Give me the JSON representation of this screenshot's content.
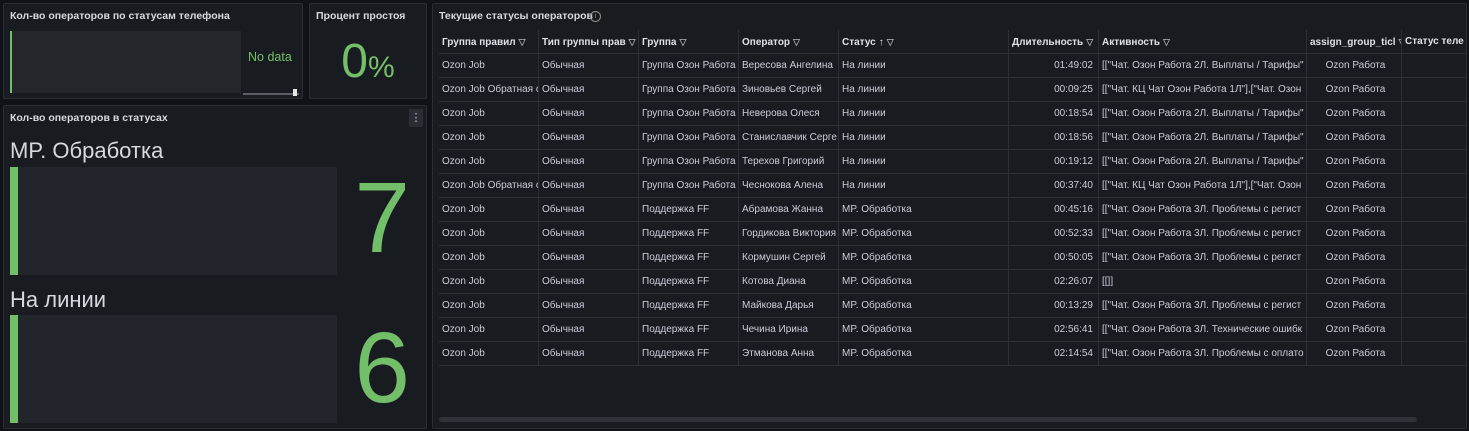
{
  "colors": {
    "accent": "#73bf69",
    "panel_bg": "#181b1f",
    "page_bg": "#111217"
  },
  "panel_phone_status": {
    "title": "Кол-во операторов по статусам телефона",
    "no_data": "No data"
  },
  "panel_idle": {
    "title": "Процент простоя",
    "value": "0",
    "unit": "%"
  },
  "panel_statuses": {
    "title": "Кол-во операторов в статусах",
    "menu_icon": "vertical-dots-icon",
    "items": [
      {
        "label": "MP. Обработка",
        "value": "7"
      },
      {
        "label": "На линии",
        "value": "6"
      }
    ]
  },
  "panel_table": {
    "title": "Текущие статусы операторов",
    "info_icon": "info-icon",
    "headers": [
      "Группа правил",
      "Тип группы прав",
      "Группа",
      "Оператор",
      "Статус",
      "Длительность",
      "Активность",
      "assign_group_ticl",
      "Статус теле"
    ],
    "sort_column": "Статус",
    "sort_direction": "asc",
    "rows": [
      [
        "Ozon Job",
        "Обычная",
        "Группа Озон Работа",
        "Вересова Ангелина",
        "На линии",
        "01:49:02",
        "[[\"Чат. Озон Работа 2Л. Выплаты / Тарифы\"",
        "Ozon Работа",
        ""
      ],
      [
        "Ozon Job Обратная с",
        "Обычная",
        "Группа Озон Работа",
        "Зиновьев Сергей",
        "На линии",
        "00:09:25",
        "[[\"Чат. КЦ Чат Озон Работа 1Л\"],[\"Чат. Озон",
        "Ozon Работа",
        ""
      ],
      [
        "Ozon Job",
        "Обычная",
        "Группа Озон Работа",
        "Неверова Олеся",
        "На линии",
        "00:18:54",
        "[[\"Чат. Озон Работа 2Л. Выплаты / Тарифы\"",
        "Ozon Работа",
        ""
      ],
      [
        "Ozon Job",
        "Обычная",
        "Группа Озон Работа",
        "Станиславчик Серге",
        "На линии",
        "00:18:56",
        "[[\"Чат. Озон Работа 2Л. Выплаты / Тарифы\"",
        "Ozon Работа",
        ""
      ],
      [
        "Ozon Job",
        "Обычная",
        "Группа Озон Работа",
        "Терехов Григорий",
        "На линии",
        "00:19:12",
        "[[\"Чат. Озон Работа 2Л. Выплаты / Тарифы\"",
        "Ozon Работа",
        ""
      ],
      [
        "Ozon Job Обратная с",
        "Обычная",
        "Группа Озон Работа",
        "Чеснокова Алена",
        "На линии",
        "00:37:40",
        "[[\"Чат. КЦ Чат Озон Работа 1Л\"],[\"Чат. Озон",
        "Ozon Работа",
        ""
      ],
      [
        "Ozon Job",
        "Обычная",
        "Поддержка FF",
        "Абрамова Жанна",
        "MP. Обработка",
        "00:45:16",
        "[[\"Чат. Озон Работа 3Л. Проблемы с регист",
        "Ozon Работа",
        ""
      ],
      [
        "Ozon Job",
        "Обычная",
        "Поддержка FF",
        "Гордикова Виктория",
        "MP. Обработка",
        "00:52:33",
        "[[\"Чат. Озон Работа 3Л. Проблемы с регист",
        "Ozon Работа",
        ""
      ],
      [
        "Ozon Job",
        "Обычная",
        "Поддержка FF",
        "Кормушин Сергей",
        "MP. Обработка",
        "00:50:05",
        "[[\"Чат. Озон Работа 3Л. Проблемы с регист",
        "Ozon Работа",
        ""
      ],
      [
        "Ozon Job",
        "Обычная",
        "Поддержка FF",
        "Котова Диана",
        "MP. Обработка",
        "02:26:07",
        "[[]]",
        "Ozon Работа",
        ""
      ],
      [
        "Ozon Job",
        "Обычная",
        "Поддержка FF",
        "Майкова Дарья",
        "MP. Обработка",
        "00:13:29",
        "[[\"Чат. Озон Работа 3Л. Проблемы с регист",
        "Ozon Работа",
        ""
      ],
      [
        "Ozon Job",
        "Обычная",
        "Поддержка FF",
        "Чечина Ирина",
        "MP. Обработка",
        "02:56:41",
        "[[\"Чат. Озон Работа 3Л. Технические ошибк",
        "Ozon Работа",
        ""
      ],
      [
        "Ozon Job",
        "Обычная",
        "Поддержка FF",
        "Этманова Анна",
        "MP. Обработка",
        "02:14:54",
        "[[\"Чат. Озон Работа 3Л. Проблемы с оплато",
        "Ozon Работа",
        ""
      ]
    ]
  }
}
